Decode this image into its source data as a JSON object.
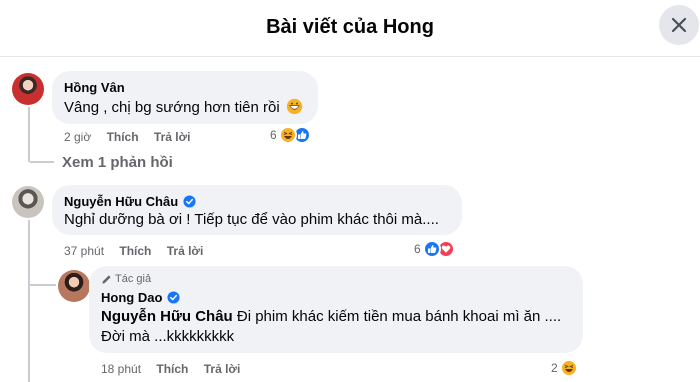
{
  "header": {
    "title": "Bài viết của Hong"
  },
  "actions": {
    "like": "Thích",
    "reply": "Trả lời"
  },
  "comments": [
    {
      "author": "Hồng Vân",
      "text": "Vâng , chị bg sướng hơn tiên rồi",
      "time": "2 giờ",
      "reaction_count": "6",
      "view_replies": "Xem 1 phản hồi"
    },
    {
      "author": "Nguyễn Hữu Châu",
      "verified": true,
      "text": "Nghỉ dưỡng bà ơi ! Tiếp tục để vào phim khác thôi mà....",
      "time": "37 phút",
      "reaction_count": "6"
    }
  ],
  "reply": {
    "tag": "Tác giả",
    "author": "Hong Dao",
    "verified": true,
    "mention": "Nguyễn Hữu Châu",
    "text_line1": " Đi phim khác kiếm tiền mua bánh khoai mì ăn ....",
    "text_line2": "Đời mà ...kkkkkkkkk",
    "time": "18 phút",
    "reaction_count": "2"
  },
  "colors": {
    "like_blue": "#1877f2",
    "love_red": "#f33e58",
    "haha_yellow": "#f7b125",
    "verified_blue": "#1877f2"
  }
}
